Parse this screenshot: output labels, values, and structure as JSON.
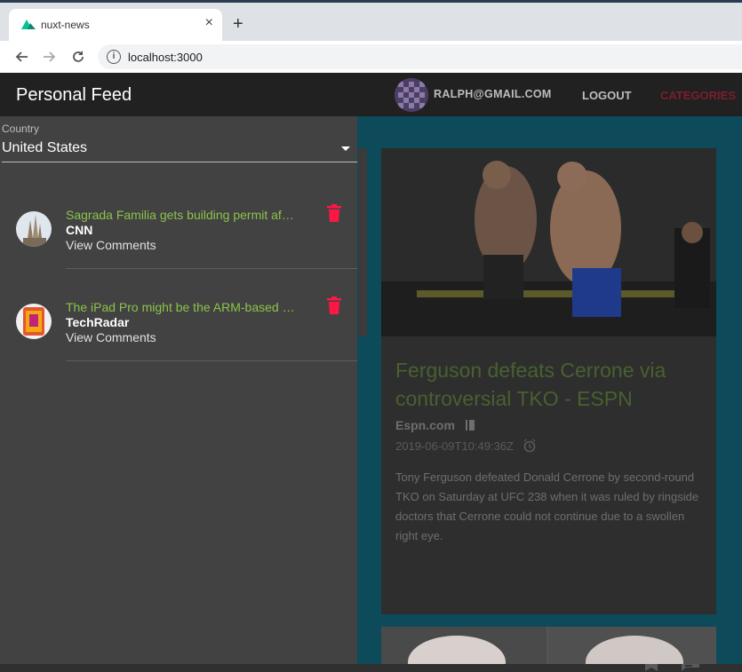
{
  "browser": {
    "tab_title": "nuxt-news",
    "tab_close": "×",
    "new_tab": "+",
    "url": "localhost:3000"
  },
  "app_bar": {
    "user_email": "RALPH@GMAIL.COM",
    "logout_label": "LOGOUT",
    "categories_label": "CATEGORIES"
  },
  "article": {
    "title": "Ferguson defeats Cerrone via controversial TKO - ESPN",
    "source": "Espn.com",
    "date": "2019-06-09T10:49:36Z",
    "description": "Tony Ferguson defeated Donald Cerrone by second-round TKO on Saturday at UFC 238 when it was ruled by ringside doctors that Cerrone could not continue due to a swollen right eye."
  },
  "drawer": {
    "title": "Personal Feed",
    "country_label": "Country",
    "country_value": "United States",
    "items": [
      {
        "title": "Sagrada Familia gets building permit af…",
        "source": "CNN",
        "comments_label": "View Comments"
      },
      {
        "title": "The iPad Pro might be the ARM-based …",
        "source": "TechRadar",
        "comments_label": "View Comments"
      }
    ]
  },
  "colors": {
    "feed_title": "#8bc34a",
    "delete_icon": "#ff1744",
    "app_bar": "#212121",
    "drawer_bg": "#424242",
    "page_bg": "#0d4a5a"
  }
}
